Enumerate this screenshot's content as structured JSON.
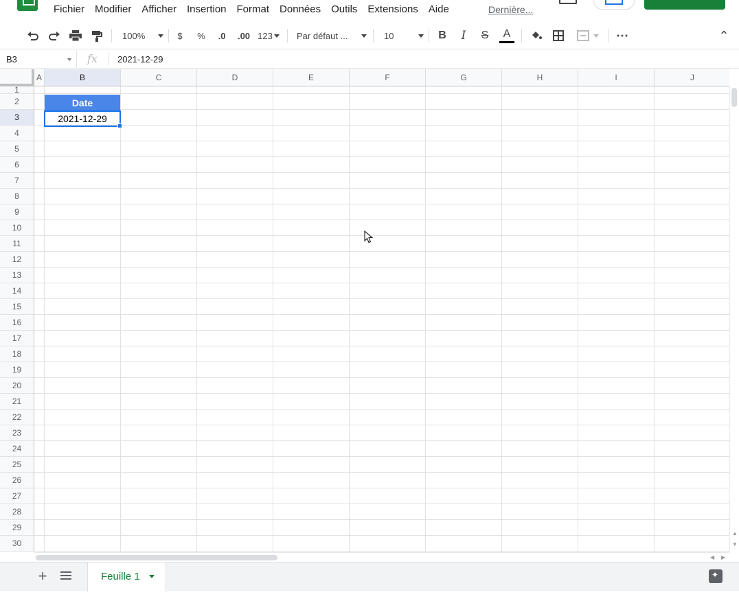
{
  "menu": {
    "items": [
      "Fichier",
      "Modifier",
      "Afficher",
      "Insertion",
      "Format",
      "Données",
      "Outils",
      "Extensions",
      "Aide"
    ],
    "last_edit": "Dernière..."
  },
  "toolbar": {
    "zoom": "100%",
    "currency": "$",
    "percent": "%",
    "decrease_decimals": ".0",
    "increase_decimals": ".00",
    "more_formats": "123",
    "font": "Par défaut ...",
    "font_size": "10",
    "bold": "B",
    "italic": "I",
    "strike": "S",
    "text_color": "A",
    "more": "⋯",
    "collapse": "⌃"
  },
  "formula_bar": {
    "name_box": "B3",
    "fx": "fx",
    "value": "2021-12-29"
  },
  "grid": {
    "columns": [
      {
        "label": "A",
        "selected": false
      },
      {
        "label": "B",
        "selected": true
      },
      {
        "label": "C",
        "selected": false
      },
      {
        "label": "D",
        "selected": false
      },
      {
        "label": "E",
        "selected": false
      },
      {
        "label": "F",
        "selected": false
      },
      {
        "label": "G",
        "selected": false
      },
      {
        "label": "H",
        "selected": false
      },
      {
        "label": "I",
        "selected": false
      },
      {
        "label": "J",
        "selected": false
      }
    ],
    "rows": [
      "1",
      "2",
      "3",
      "4",
      "5",
      "6",
      "7",
      "8",
      "9",
      "10",
      "11",
      "12",
      "13",
      "14",
      "15",
      "16",
      "17",
      "18",
      "19",
      "20",
      "21",
      "22",
      "23",
      "24",
      "25",
      "26",
      "27",
      "28",
      "29",
      "30"
    ],
    "selected_row": "3",
    "cells": {
      "B2": "Date",
      "B3": "2021-12-29"
    },
    "header_fill": "#4a86e8",
    "selection_color": "#1a73e8"
  },
  "sheets": {
    "active": "Feuille 1"
  }
}
